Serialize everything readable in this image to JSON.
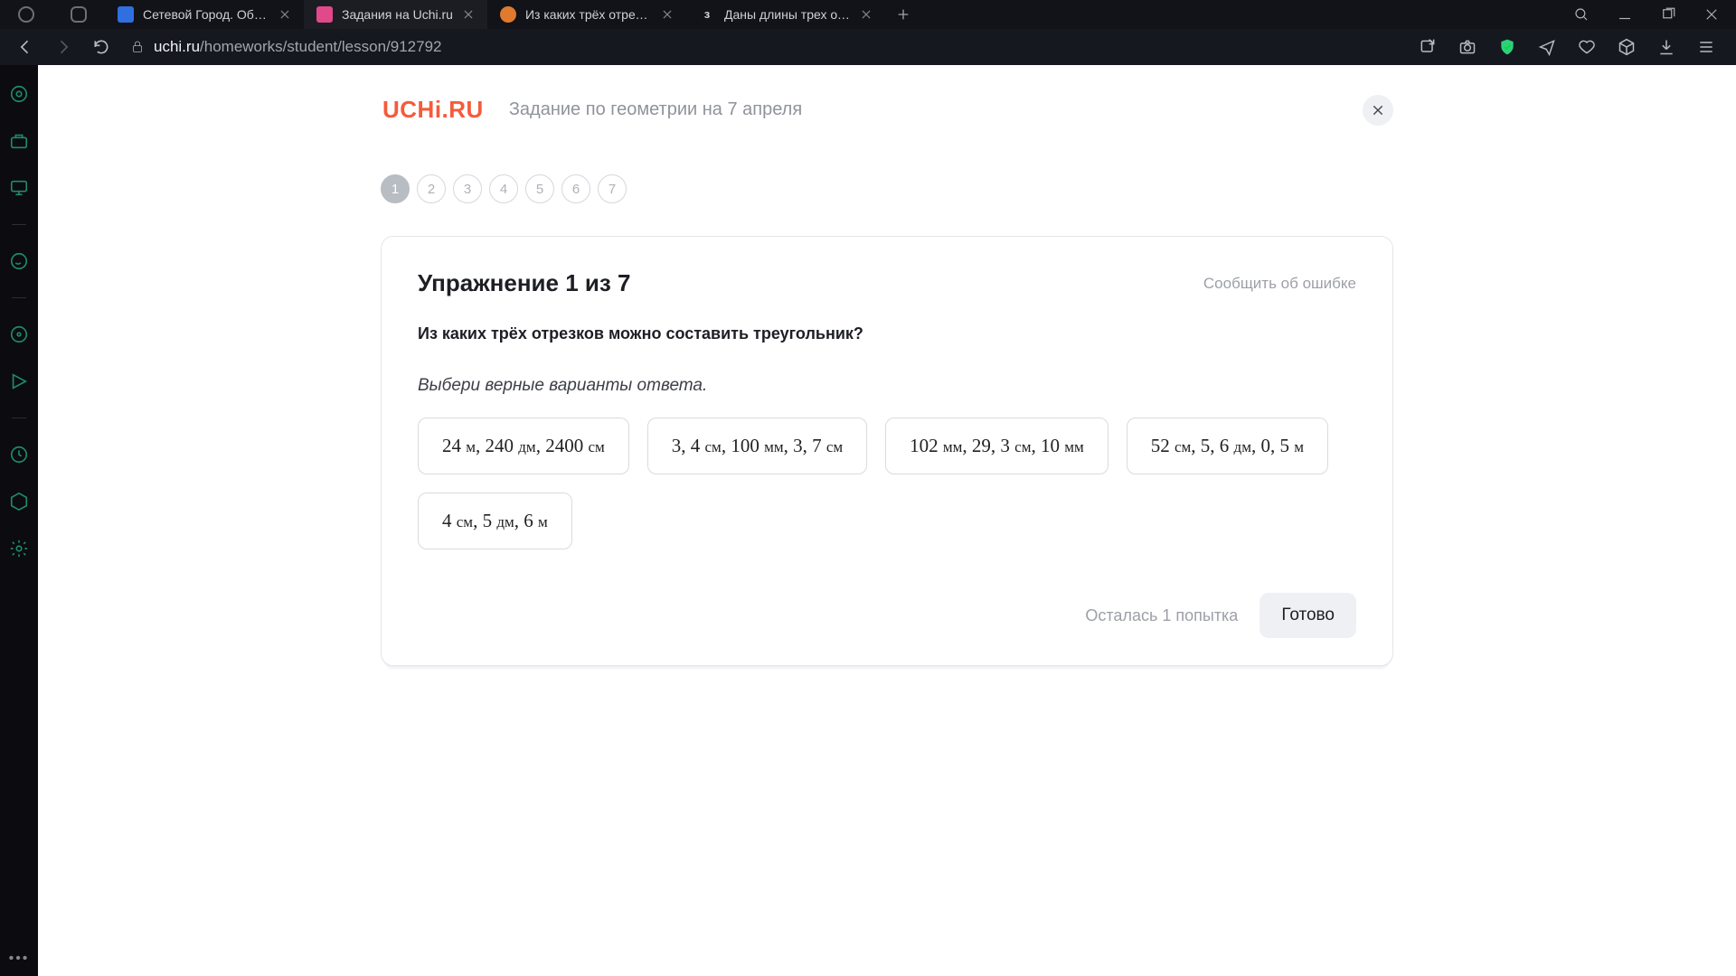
{
  "chrome": {
    "tabs": [
      {
        "label": "Сетевой Город. Образова"
      },
      {
        "label": "Задания на Uchi.ru"
      },
      {
        "label": "Из каких трёх отрезков м"
      },
      {
        "label": "Даны длины трех отрезко"
      }
    ],
    "url_domain": "uchi.ru",
    "url_path": "/homeworks/student/lesson/912792"
  },
  "page": {
    "brand": "UCHi.RU",
    "subtitle": "Задание по геометрии на 7 апреля",
    "steps": [
      "1",
      "2",
      "3",
      "4",
      "5",
      "6",
      "7"
    ],
    "active_step_index": 0,
    "exercise_title": "Упражнение 1 из 7",
    "report_link": "Сообщить об ошибке",
    "question": "Из каких трёх отрезков можно составить треугольник?",
    "hint": "Выбери верные варианты ответа.",
    "options": [
      [
        {
          "n": "24",
          "u": "м"
        },
        {
          "n": "240",
          "u": "дм"
        },
        {
          "n": "2400",
          "u": "см"
        }
      ],
      [
        {
          "n": "3, 4",
          "u": "см"
        },
        {
          "n": "100",
          "u": "мм"
        },
        {
          "n": "3, 7",
          "u": "см"
        }
      ],
      [
        {
          "n": "102",
          "u": "мм"
        },
        {
          "n": "29, 3",
          "u": "см"
        },
        {
          "n": "10",
          "u": "мм"
        }
      ],
      [
        {
          "n": "52",
          "u": "см"
        },
        {
          "n": "5, 6",
          "u": "дм"
        },
        {
          "n": "0, 5",
          "u": "м"
        }
      ],
      [
        {
          "n": "4",
          "u": "см"
        },
        {
          "n": "5",
          "u": "дм"
        },
        {
          "n": "6",
          "u": "м"
        }
      ]
    ],
    "attempts_text": "Осталась 1 попытка",
    "done_label": "Готово"
  }
}
